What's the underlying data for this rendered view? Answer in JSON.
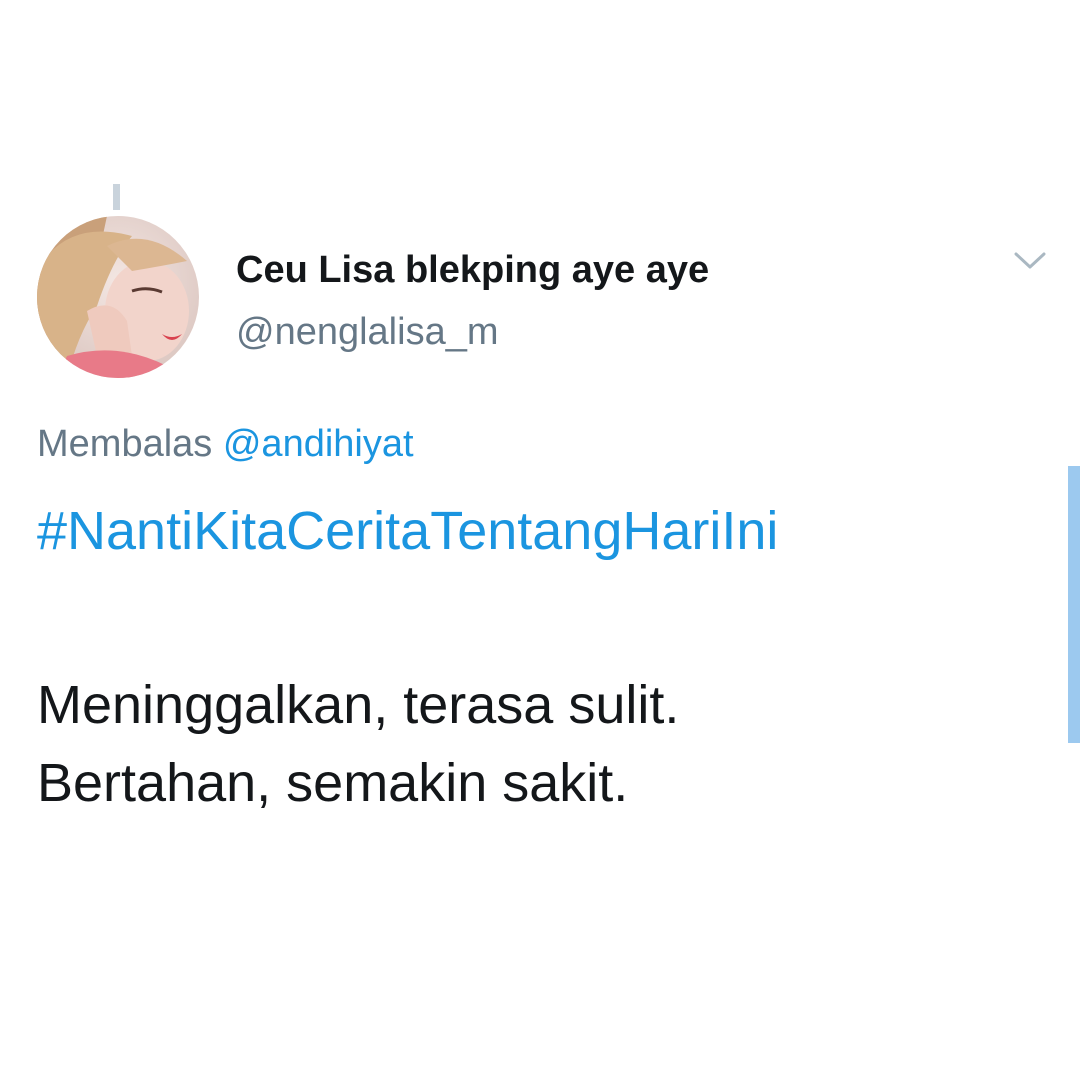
{
  "tweet": {
    "author": {
      "display_name": "Ceu Lisa blekping aye aye",
      "handle": "@nenglalisa_m"
    },
    "reply_prefix": "Membalas",
    "reply_to": "@andihiyat",
    "hashtag": "#NantiKitaCeritaTentangHariIni",
    "body_lines": [
      "Meninggalkan, terasa sulit.",
      "Bertahan, semakin sakit."
    ]
  },
  "icons": {
    "menu": "chevron-down-icon"
  },
  "colors": {
    "link": "#1b95e0",
    "text": "#14171a",
    "secondary": "#657786",
    "scrollbar": "#9cc9ef"
  }
}
